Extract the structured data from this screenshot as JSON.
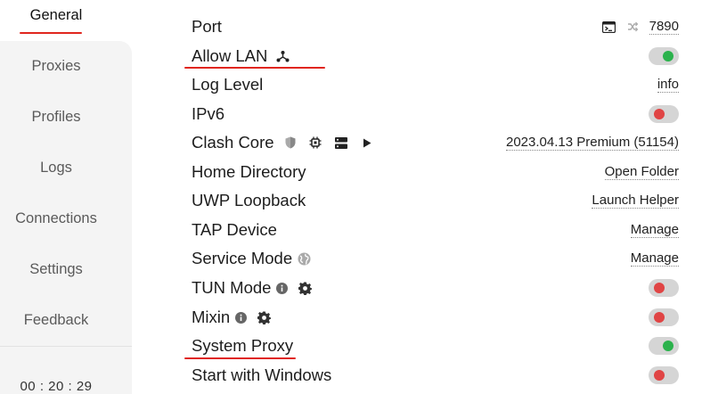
{
  "sidebar": {
    "items": [
      {
        "label": "General",
        "active": true
      },
      {
        "label": "Proxies"
      },
      {
        "label": "Profiles"
      },
      {
        "label": "Logs"
      },
      {
        "label": "Connections"
      },
      {
        "label": "Settings"
      },
      {
        "label": "Feedback"
      }
    ],
    "clock": "00 : 20 : 29"
  },
  "settings": {
    "port": {
      "label": "Port",
      "value": "7890",
      "icons": [
        "terminal-icon",
        "random-port-icon"
      ]
    },
    "allow_lan": {
      "label": "Allow LAN",
      "icon": "network-icon",
      "toggle": "on"
    },
    "log_level": {
      "label": "Log Level",
      "value": "info"
    },
    "ipv6": {
      "label": "IPv6",
      "toggle": "off"
    },
    "clash_core": {
      "label": "Clash Core",
      "value": "2023.04.13 Premium (51154)",
      "icons": [
        "shield-icon",
        "chip-icon",
        "server-icon",
        "play-icon"
      ]
    },
    "home_directory": {
      "label": "Home Directory",
      "action": "Open Folder"
    },
    "uwp_loopback": {
      "label": "UWP Loopback",
      "action": "Launch Helper"
    },
    "tap_device": {
      "label": "TAP Device",
      "action": "Manage"
    },
    "service_mode": {
      "label": "Service Mode",
      "icon": "globe-icon",
      "action": "Manage"
    },
    "tun_mode": {
      "label": "TUN Mode",
      "icons": [
        "info-icon",
        "gear-icon"
      ],
      "toggle": "off"
    },
    "mixin": {
      "label": "Mixin",
      "icons": [
        "info-icon",
        "gear-icon"
      ],
      "toggle": "off"
    },
    "system_proxy": {
      "label": "System Proxy",
      "toggle": "on"
    },
    "start_with_windows": {
      "label": "Start with Windows",
      "toggle": "off"
    }
  },
  "colors": {
    "on": "#2bb24c",
    "off": "#e04545",
    "annotation": "#e0261e",
    "sidebar_bg": "#f4f4f4"
  }
}
